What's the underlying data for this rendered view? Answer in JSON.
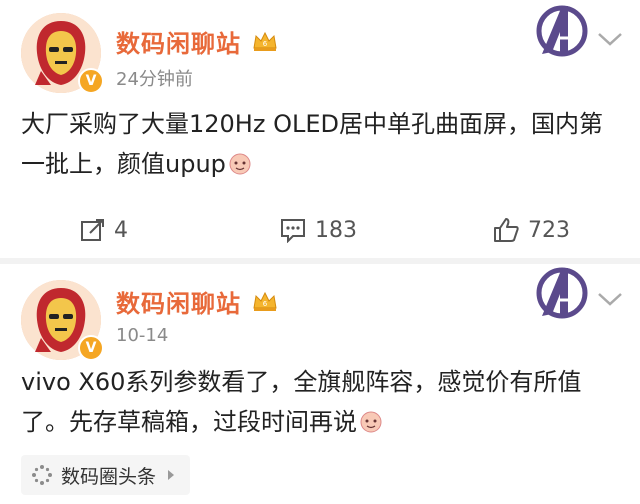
{
  "posts": [
    {
      "author": "数码闲聊站",
      "time": "24分钟前",
      "verified_badge": "V",
      "content": "大厂采购了大量120Hz OLED居中单孔曲面屏，国内第一批上，颜值upup",
      "actions": {
        "repost": "4",
        "comment": "183",
        "like": "723"
      }
    },
    {
      "author": "数码闲聊站",
      "time": "10-14",
      "verified_badge": "V",
      "content": "vivo X60系列参数看了，全旗舰阵容，感觉价有所值了。先存草稿箱，过段时间再说",
      "topic": {
        "label": "数码圈头条"
      }
    }
  ],
  "colors": {
    "author": "#e8693a",
    "muted": "#8a8a8a",
    "verified": "#f5a623"
  },
  "icons": [
    "iron-man-avatar",
    "crown-icon",
    "avengers-logo",
    "chevron-down-icon",
    "repost-icon",
    "comment-icon",
    "like-icon",
    "emoji-icon",
    "topic-icon",
    "chevron-right-icon"
  ]
}
